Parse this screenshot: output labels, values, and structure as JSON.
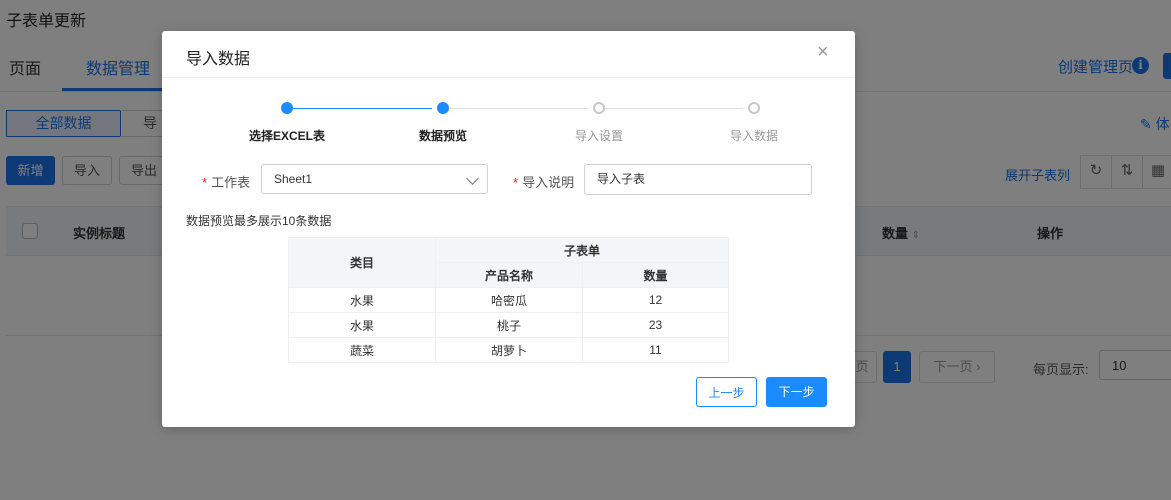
{
  "page": {
    "title": "子表单更新",
    "tabs": [
      {
        "label": "页面"
      },
      {
        "label": "数据管理"
      }
    ],
    "create_link": "创建管理页",
    "info_glyph": "i",
    "filters": {
      "all": "全部数据",
      "next": "导"
    },
    "toolbar": {
      "add": "新增",
      "import": "导入",
      "export": "导出",
      "expand": "展开子表列",
      "right_edge": "体"
    },
    "table_headers": {
      "title": "实例标题",
      "quantity": "数量",
      "actions": "操作"
    },
    "pager": {
      "prev": "页",
      "current": "1",
      "next": "下一页",
      "per_page_label": "每页显示:",
      "per_page_value": "10"
    }
  },
  "modal": {
    "title": "导入数据",
    "close": "×",
    "steps": [
      {
        "label": "选择EXCEL表",
        "state": "done"
      },
      {
        "label": "数据预览",
        "state": "done"
      },
      {
        "label": "导入设置",
        "state": "todo"
      },
      {
        "label": "导入数据",
        "state": "todo"
      }
    ],
    "form": {
      "required_mark": "*",
      "sheet_label": "工作表",
      "sheet_value": "Sheet1",
      "note_label": "导入说明",
      "note_value": "导入子表"
    },
    "preview_note": "数据预览最多展示10条数据",
    "preview_table": {
      "category_header": "类目",
      "group_header": "子表单",
      "sub_headers": [
        "产品名称",
        "数量"
      ],
      "rows": [
        [
          "水果",
          "哈密瓜",
          "12"
        ],
        [
          "水果",
          "桃子",
          "23"
        ],
        [
          "蔬菜",
          "胡萝卜",
          "11"
        ]
      ]
    },
    "buttons": {
      "prev": "上一步",
      "next": "下一步"
    }
  },
  "colors": {
    "accent": "#1a73e8",
    "step_active": "#1a8cff",
    "overlay": "rgba(0,0,0,0.5)"
  }
}
